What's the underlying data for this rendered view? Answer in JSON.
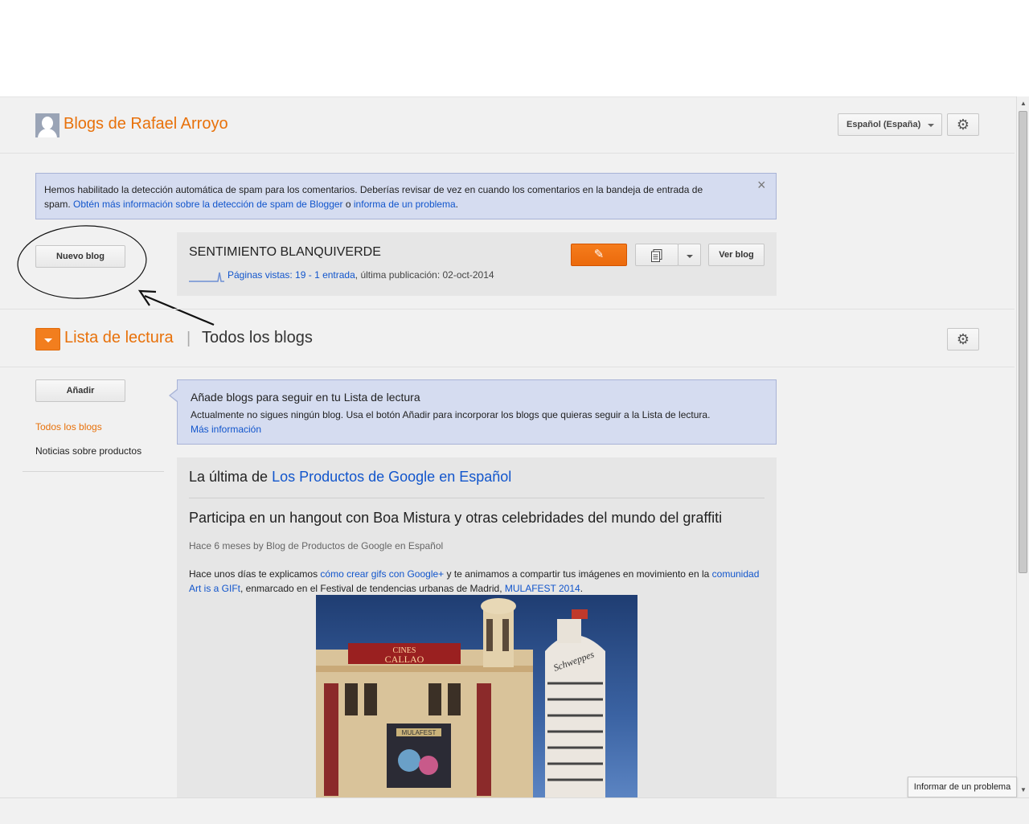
{
  "header": {
    "title": "Blogs de Rafael Arroyo",
    "language": "Español (España)"
  },
  "spam_notice": {
    "text": "Hemos habilitado la detección automática de spam para los comentarios. Deberías revisar de vez en cuando los comentarios en la bandeja de entrada de spam. ",
    "link1": "Obtén más información sobre la detección de spam de Blogger",
    "connector": " o ",
    "link2": "informa de un problema",
    "end": ".",
    "close": "×"
  },
  "new_blog_button": "Nuevo blog",
  "blog": {
    "name": "SENTIMIENTO BLANQUIVERDE",
    "page_views": "Páginas vistas: 19",
    "dash": " - ",
    "entries": "1 entrada",
    "last_post": ", última publicación: 02-oct-2014",
    "view_label": "Ver blog"
  },
  "reading_list": {
    "title": "Lista de lectura",
    "separator": "|",
    "all_blogs": "Todos los blogs",
    "add_button": "Añadir",
    "sidebar": [
      "Todos los blogs",
      "Noticias sobre productos"
    ],
    "notice_title": "Añade blogs para seguir en tu Lista de lectura",
    "notice_text": "Actualmente no sigues ningún blog. Usa el botón Añadir para incorporar los blogs que quieras seguir a la Lista de lectura.",
    "notice_link": "Más información"
  },
  "feed": {
    "heading_prefix": "La última de ",
    "heading_link": "Los Productos de Google en Español",
    "post_title": "Participa en un hangout con Boa Mistura y otras celebridades del mundo del graffiti",
    "post_meta": "Hace 6 meses by Blog de Productos de Google en Español",
    "body_1": "Hace unos días te explicamos ",
    "body_link1": "cómo crear gifs con Google+",
    "body_2": " y te animamos a compartir tus imágenes en movimiento en la ",
    "body_link2": "comunidad Art is a GIFt",
    "body_3": ", enmarcado en el Festival de tendencias urbanas de Madrid, ",
    "body_link3": "MULAFEST 2014",
    "body_4": ".",
    "photo_sign1": "CINES",
    "photo_sign2": "CALLAO",
    "photo_banner": "MULAFEST",
    "photo_schweppes": "Schweppes"
  },
  "report_problem": "Informar de un problema",
  "colors": {
    "accent_orange": "#e8710a",
    "notice_blue": "#d5dcf0",
    "link_blue": "#1155cc"
  }
}
